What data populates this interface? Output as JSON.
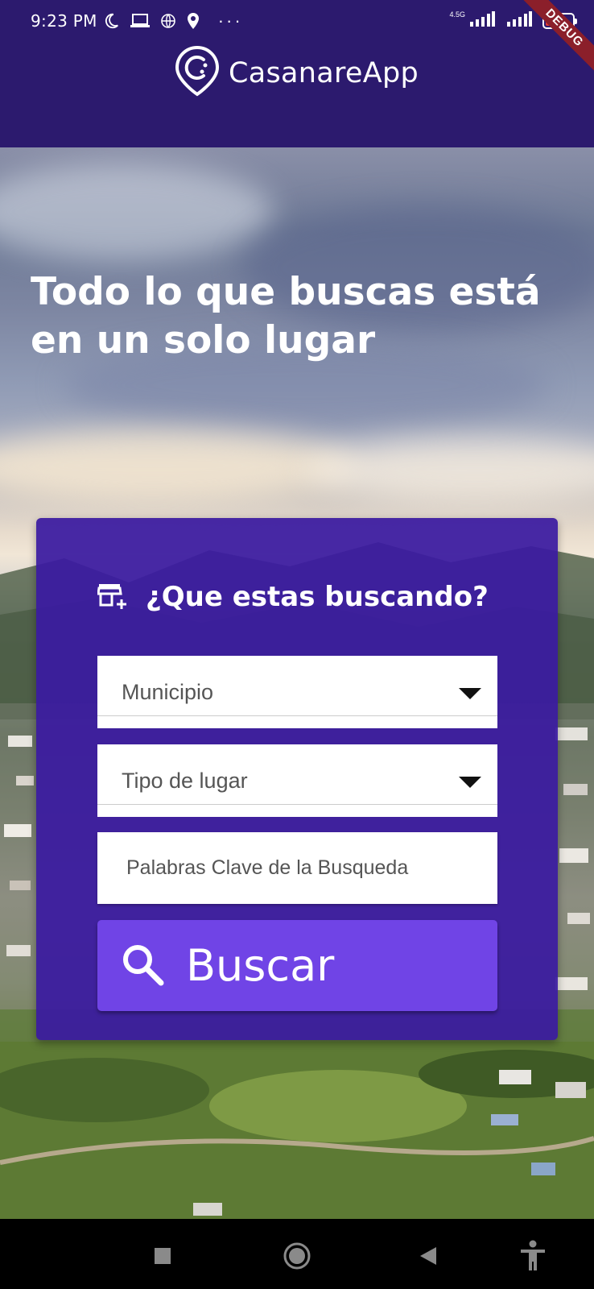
{
  "status_bar": {
    "time": "9:23 PM",
    "network": "4.5G",
    "battery": "9"
  },
  "debug_ribbon": "DEBUG",
  "header": {
    "app_name": "CasanareApp"
  },
  "hero": {
    "headline": "Todo lo que buscas está en un solo lugar"
  },
  "search_card": {
    "title": "¿Que estas buscando?",
    "municipio_label": "Municipio",
    "tipo_lugar_label": "Tipo de lugar",
    "keywords_placeholder": "Palabras Clave de la Busqueda",
    "search_button_label": "Buscar"
  },
  "icons": {
    "status": [
      "moon-icon",
      "laptop-icon",
      "globe-icon",
      "location-pin-icon",
      "more-dots-icon",
      "signal-icon",
      "battery-icon"
    ],
    "card": [
      "store-add-icon",
      "search-icon",
      "dropdown-caret-icon"
    ],
    "nav": [
      "recents-square-icon",
      "home-circle-icon",
      "back-triangle-icon",
      "accessibility-icon"
    ]
  },
  "colors": {
    "header_bg": "#2c1a6e",
    "card_bg": "#3a1aa0",
    "button_bg": "#7044e6",
    "text_on_dark": "#ffffff"
  }
}
